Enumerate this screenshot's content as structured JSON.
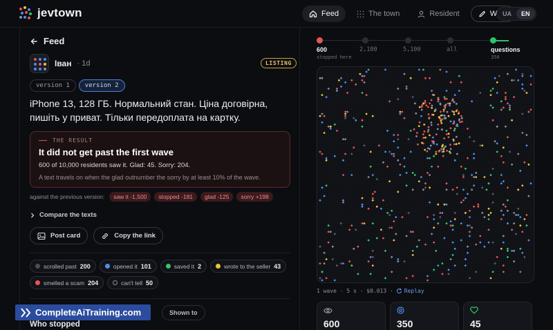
{
  "app": {
    "name": "jevtown"
  },
  "nav": {
    "feed": "Feed",
    "town": "The town",
    "resident": "Resident",
    "write": "Write",
    "lang_ua": "UA",
    "lang_en": "EN"
  },
  "post": {
    "back_label": "Feed",
    "author": "Іван",
    "time": "· 1d",
    "badge": "LISTING",
    "versions": [
      "version 1",
      "version 2"
    ],
    "text": "iPhone 13, 128 ГБ. Нормальний стан. Ціна договірна, пишіть у приват. Тільки передоплата на картку."
  },
  "result": {
    "kicker": "THE RESULT",
    "title": "It did not get past the first wave",
    "stats": "600 of 10,000 residents saw it. Glad: 45. Sorry: 204.",
    "explanation": "A text travels on when the glad outnumber the sorry by at least 10% of the wave."
  },
  "comparison": {
    "label": "against the previous version:",
    "chips": [
      "saw it -1,500",
      "stopped -181",
      "glad -125",
      "sorry +198"
    ]
  },
  "compare_label": "Compare the texts",
  "actions": {
    "post_card": "Post card",
    "copy_link": "Copy the link"
  },
  "reactions": [
    {
      "label": "scrolled past",
      "count": "200",
      "color": "#4a4d56",
      "ring": false
    },
    {
      "label": "opened it",
      "count": "101",
      "color": "#4d8ff0",
      "ring": false
    },
    {
      "label": "saved it",
      "count": "2",
      "color": "#38c46a",
      "ring": false
    },
    {
      "label": "wrote to the seller",
      "count": "43",
      "color": "#f0c23b",
      "ring": false
    },
    {
      "label": "smelled a scam",
      "count": "204",
      "color": "#e5574f",
      "ring": false
    },
    {
      "label": "can't tell",
      "count": "50",
      "color": "#8d9099",
      "ring": true
    }
  ],
  "shown_to": "Shown to",
  "who_stopped": "Who stopped",
  "watermark": "CompleteAiTraining.com",
  "timeline": {
    "stages": [
      "600",
      "2,100",
      "5,100",
      "all",
      "questions"
    ],
    "stopped_here": "stopped here",
    "questions_count": "350",
    "stopped_color": "#e5574f",
    "questions_color": "#2fc46a"
  },
  "viz_footer": {
    "meta": "1 wave · 5 s · $0.013 ·",
    "replay": "Replay"
  },
  "stat_cards": [
    {
      "icon": "eye-icon",
      "value": "600",
      "color": "#9ea1aa"
    },
    {
      "icon": "target-icon",
      "value": "350",
      "color": "#4d8ff0"
    },
    {
      "icon": "heart-icon",
      "value": "45",
      "color": "#38c46a"
    }
  ]
}
